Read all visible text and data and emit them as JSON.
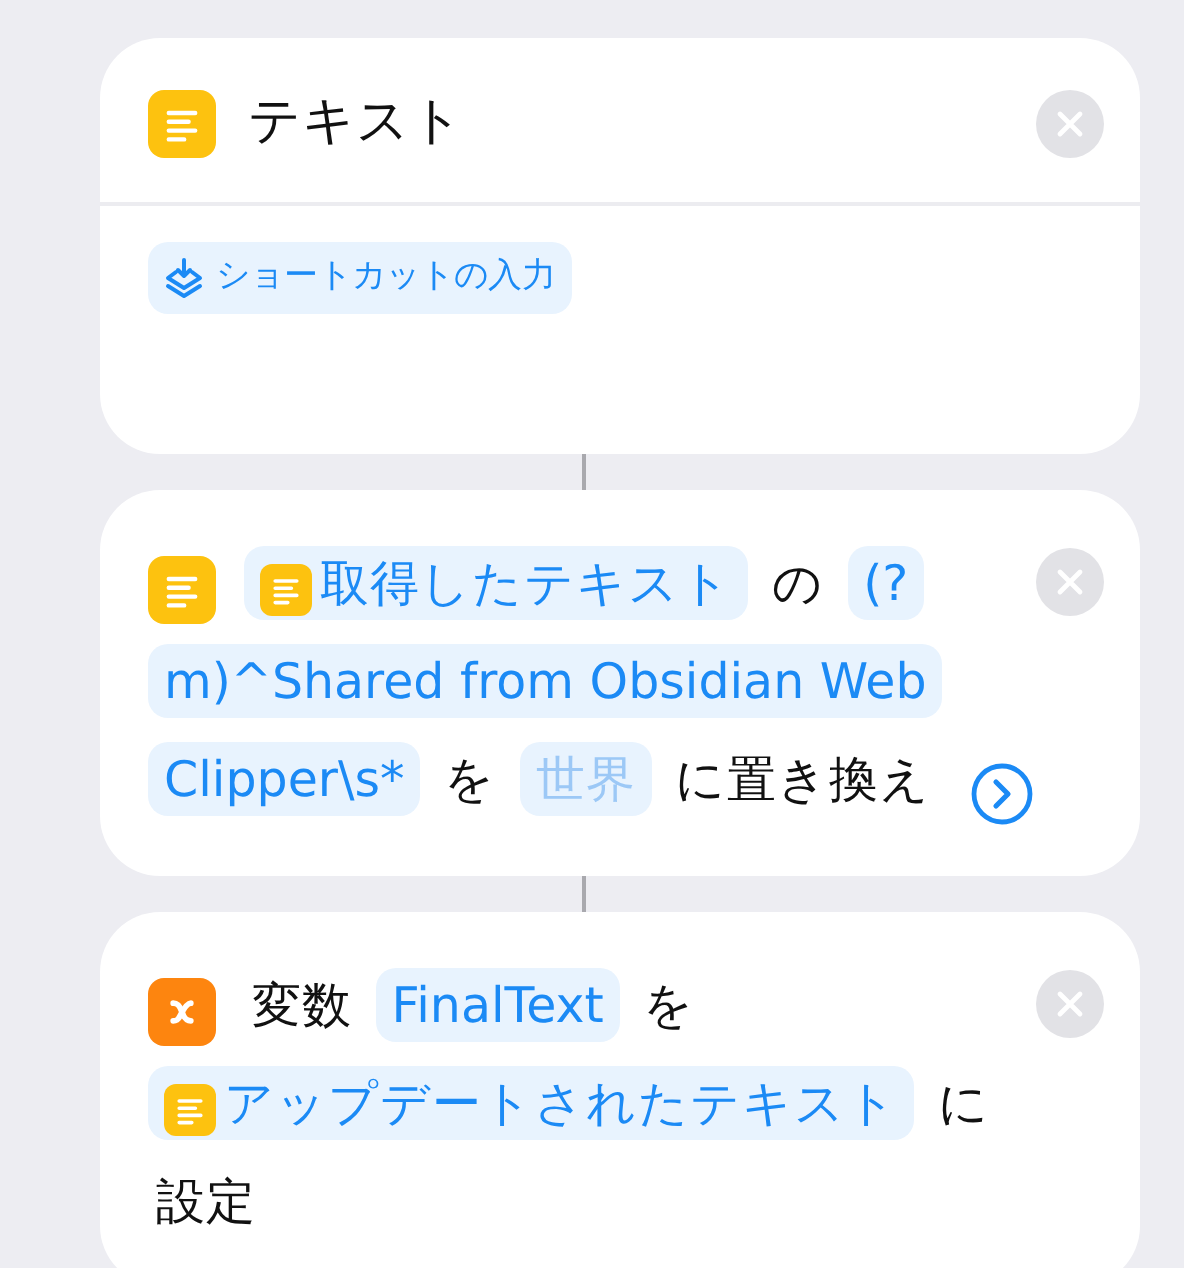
{
  "actions": [
    {
      "kind": "text",
      "title": "テキスト",
      "body": [
        {
          "kind": "shortcut_input",
          "text": "ショートカットの入力"
        }
      ]
    },
    {
      "kind": "replace_text",
      "expanded": false,
      "parts": [
        {
          "kind": "variable",
          "text": "取得したテキスト"
        },
        {
          "kind": "word",
          "text": "の"
        },
        {
          "kind": "value",
          "text": "(?m)^Shared from Obsidian Web Clipper\\s*"
        },
        {
          "kind": "word",
          "text": "を"
        },
        {
          "kind": "placeholder",
          "text": "世界"
        },
        {
          "kind": "word",
          "text": "に置き換え"
        }
      ]
    },
    {
      "kind": "set_variable",
      "parts": [
        {
          "kind": "word",
          "text": "変数"
        },
        {
          "kind": "value",
          "text": "FinalText"
        },
        {
          "kind": "word",
          "text": "を"
        },
        {
          "kind": "variable",
          "text": "アップデートされたテキスト"
        },
        {
          "kind": "word",
          "text": "に"
        },
        {
          "kind": "word",
          "text": "設定"
        }
      ]
    }
  ]
}
